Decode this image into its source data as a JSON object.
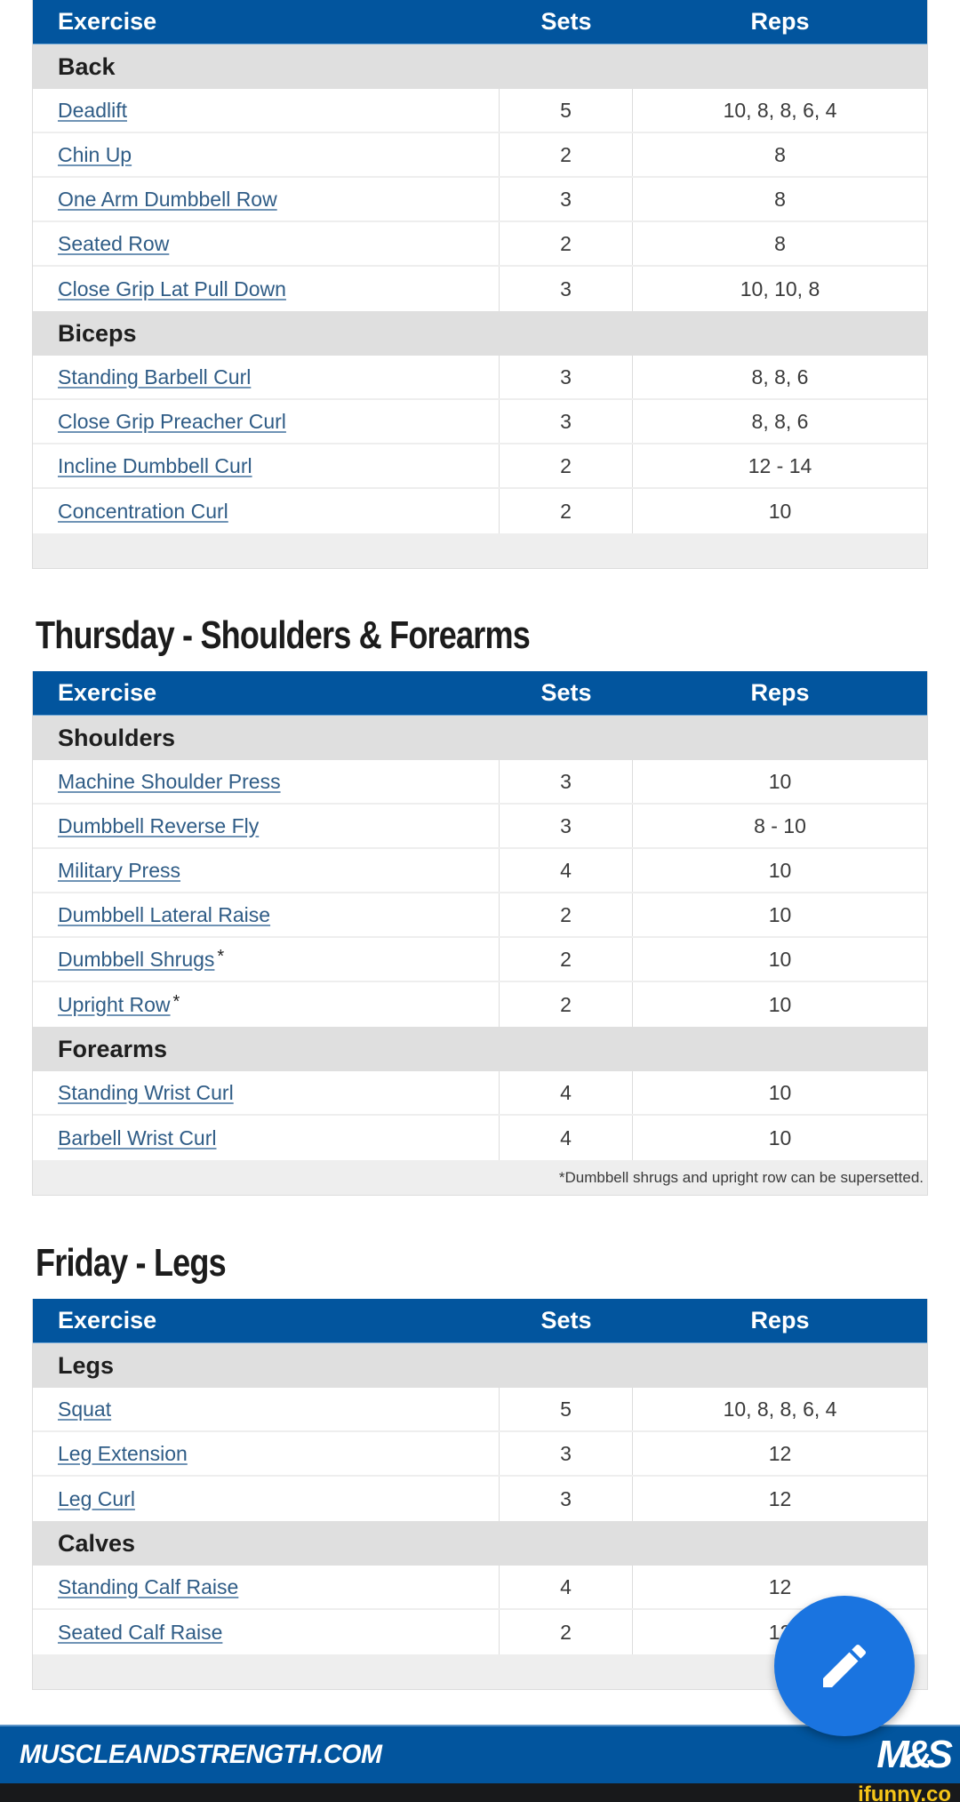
{
  "columns": {
    "exercise": "Exercise",
    "sets": "Sets",
    "reps": "Reps"
  },
  "days": [
    {
      "heading": null,
      "groups": [
        {
          "category": "Back",
          "rows": [
            {
              "exercise": "Deadlift",
              "sets": "5",
              "reps": "10, 8, 8, 6, 4",
              "asterisk": ""
            },
            {
              "exercise": "Chin Up",
              "sets": "2",
              "reps": "8",
              "asterisk": ""
            },
            {
              "exercise": "One Arm Dumbbell Row",
              "sets": "3",
              "reps": "8",
              "asterisk": ""
            },
            {
              "exercise": "Seated Row",
              "sets": "2",
              "reps": "8",
              "asterisk": ""
            },
            {
              "exercise": "Close Grip Lat Pull Down",
              "sets": "3",
              "reps": "10, 10, 8",
              "asterisk": ""
            }
          ]
        },
        {
          "category": "Biceps",
          "rows": [
            {
              "exercise": "Standing Barbell Curl",
              "sets": "3",
              "reps": "8, 8, 6",
              "asterisk": ""
            },
            {
              "exercise": "Close Grip Preacher Curl",
              "sets": "3",
              "reps": "8, 8, 6",
              "asterisk": ""
            },
            {
              "exercise": "Incline Dumbbell Curl",
              "sets": "2",
              "reps": "12 - 14",
              "asterisk": ""
            },
            {
              "exercise": "Concentration Curl",
              "sets": "2",
              "reps": "10",
              "asterisk": ""
            }
          ]
        }
      ],
      "footnote": ""
    },
    {
      "heading": "Thursday - Shoulders & Forearms",
      "groups": [
        {
          "category": "Shoulders",
          "rows": [
            {
              "exercise": "Machine Shoulder Press",
              "sets": "3",
              "reps": "10",
              "asterisk": ""
            },
            {
              "exercise": "Dumbbell Reverse Fly",
              "sets": "3",
              "reps": "8 - 10",
              "asterisk": ""
            },
            {
              "exercise": "Military Press",
              "sets": "4",
              "reps": "10",
              "asterisk": ""
            },
            {
              "exercise": "Dumbbell Lateral Raise",
              "sets": "2",
              "reps": "10",
              "asterisk": ""
            },
            {
              "exercise": "Dumbbell Shrugs",
              "sets": "2",
              "reps": "10",
              "asterisk": "*"
            },
            {
              "exercise": "Upright Row",
              "sets": "2",
              "reps": "10",
              "asterisk": "*"
            }
          ]
        },
        {
          "category": "Forearms",
          "rows": [
            {
              "exercise": "Standing Wrist Curl",
              "sets": "4",
              "reps": "10",
              "asterisk": ""
            },
            {
              "exercise": "Barbell Wrist Curl",
              "sets": "4",
              "reps": "10",
              "asterisk": ""
            }
          ]
        }
      ],
      "footnote": "*Dumbbell shrugs and upright row can be supersetted."
    },
    {
      "heading": "Friday - Legs",
      "groups": [
        {
          "category": "Legs",
          "rows": [
            {
              "exercise": "Squat",
              "sets": "5",
              "reps": "10, 8, 8, 6, 4",
              "asterisk": ""
            },
            {
              "exercise": "Leg Extension",
              "sets": "3",
              "reps": "12",
              "asterisk": ""
            },
            {
              "exercise": "Leg Curl",
              "sets": "3",
              "reps": "12",
              "asterisk": ""
            }
          ]
        },
        {
          "category": "Calves",
          "rows": [
            {
              "exercise": "Standing Calf Raise",
              "sets": "4",
              "reps": "12",
              "asterisk": ""
            },
            {
              "exercise": "Seated Calf Raise",
              "sets": "2",
              "reps": "12",
              "asterisk": ""
            }
          ]
        }
      ],
      "footnote": ""
    }
  ],
  "fab": {
    "icon": "pencil-icon",
    "color": "#1a74e0"
  },
  "banner": {
    "site": "MUSCLEANDSTRENGTH.COM",
    "logo": "M&S",
    "color": "#02559e"
  },
  "watermark": {
    "text": "ifunny.co"
  },
  "colors": {
    "header_blue": "#02559e",
    "link": "#2f5c86",
    "category_bg": "#dfdfdf"
  }
}
